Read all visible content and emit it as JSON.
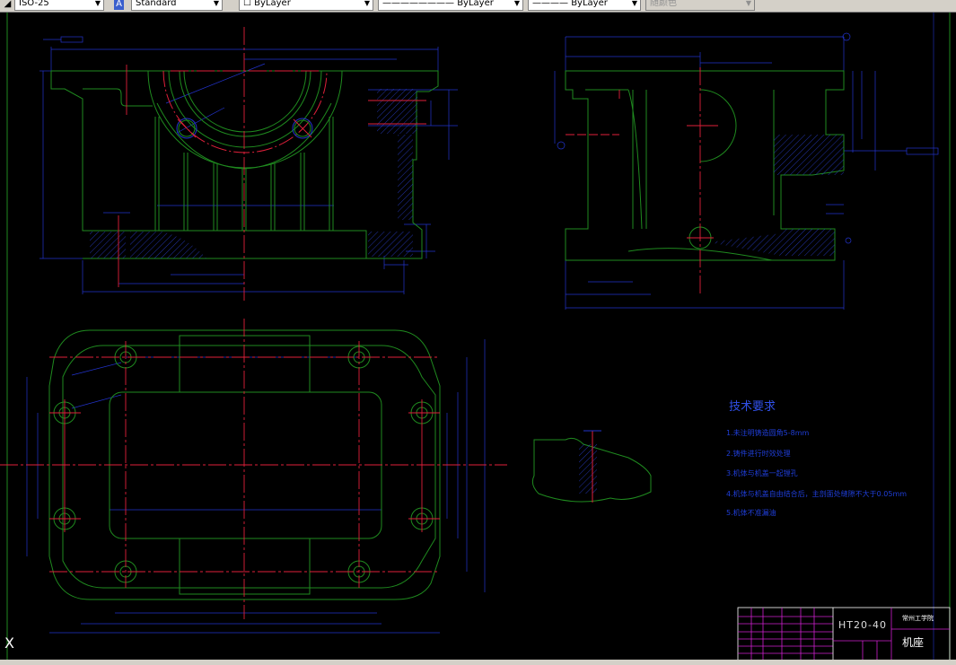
{
  "toolbar": {
    "dimstyle": "ISO-25",
    "textstyle": "Standard",
    "layer": "ByLayer",
    "linetype": "ByLayer",
    "lineweight": "ByLayer",
    "plotstyle": "随颜色"
  },
  "tech_requirements": {
    "title": "技术要求",
    "items": [
      "1.未注明铸造圆角5-8mm",
      "2.铸件进行时效处理",
      "3.机体与机盖一起镗孔",
      "4.机体与机盖自由结合后，主剖面处缝隙不大于0.05mm",
      "5.机体不准漏油"
    ]
  },
  "title_block": {
    "material": "HT20-40",
    "school": "常州工学院",
    "part_name": "机座"
  },
  "ucs_icon": "X",
  "colors": {
    "background": "#000000",
    "outline": "#1f8a1f",
    "dimension": "#2233cc",
    "centerline": "#e0203a",
    "title_block": "#d020d0"
  }
}
